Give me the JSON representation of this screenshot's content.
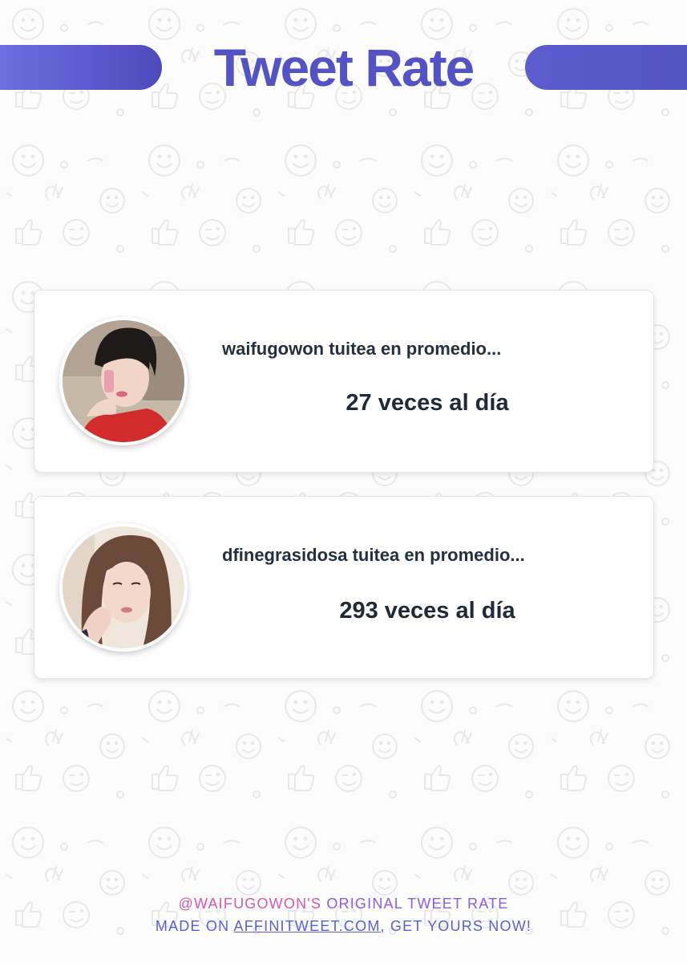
{
  "header": {
    "title": "Tweet Rate",
    "accent_colors": [
      "#6d6ee0",
      "#5353c4"
    ]
  },
  "cards": [
    {
      "avatar": "profile-photo-waifugowon",
      "label": "waifugowon tuitea en promedio...",
      "rate": "27 veces al día"
    },
    {
      "avatar": "profile-photo-dfinegrasidosa",
      "label": "dfinegrasidosa tuitea en promedio...",
      "rate": "293 veces al día"
    }
  ],
  "footer": {
    "handle": "@WAIFUGOWON'S",
    "line1_rest": " ORIGINAL TWEET RATE",
    "line2_prefix": "MADE ON ",
    "link_text": "AFFINITWEET.COM",
    "line2_suffix": ", GET YOURS NOW!"
  }
}
